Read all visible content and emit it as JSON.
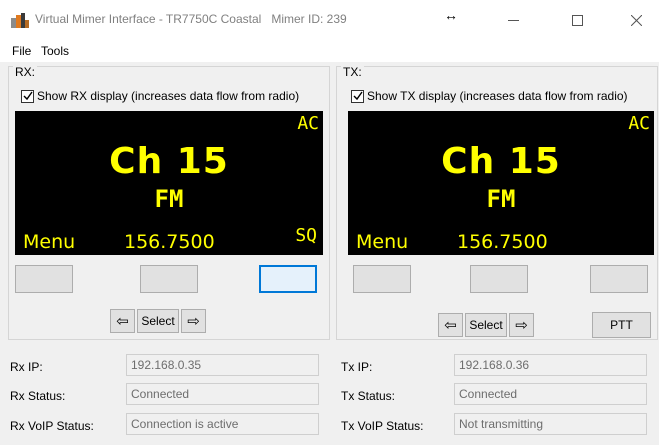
{
  "window": {
    "title": "Virtual Mimer Interface - TR7750C Coastal",
    "mimer_id": "Mimer ID: 239",
    "controls": {
      "minimize": "—",
      "maximize": "☐",
      "close": "✕"
    }
  },
  "menu": {
    "file": "File",
    "tools": "Tools"
  },
  "rx": {
    "group_label": "RX:",
    "show_display_label": "Show RX display (increases data flow from radio)",
    "show_display_checked": true,
    "display": {
      "ac": "AC",
      "channel": "Ch 15",
      "mode": "FM",
      "menu": "Menu",
      "frequency": "156.7500",
      "sq": "SQ"
    },
    "nav": {
      "left": "⇦",
      "select": "Select",
      "right": "⇨"
    }
  },
  "tx": {
    "group_label": "TX:",
    "show_display_label": "Show TX display (increases data flow from radio)",
    "show_display_checked": true,
    "display": {
      "ac": "AC",
      "channel": "Ch 15",
      "mode": "FM",
      "menu": "Menu",
      "frequency": "156.7500"
    },
    "nav": {
      "left": "⇦",
      "select": "Select",
      "right": "⇨"
    },
    "ptt": "PTT"
  },
  "status": {
    "rx_ip_label": "Rx IP:",
    "rx_ip": "192.168.0.35",
    "rx_status_label": "Rx Status:",
    "rx_status": "Connected",
    "rx_voip_label": "Rx VoIP Status:",
    "rx_voip": "Connection is active",
    "tx_ip_label": "Tx IP:",
    "tx_ip": "192.168.0.36",
    "tx_status_label": "Tx Status:",
    "tx_status": "Connected",
    "tx_voip_label": "Tx VoIP Status:",
    "tx_voip": "Not transmitting"
  },
  "colors": {
    "display_bg": "#000000",
    "display_text": "#ffff00",
    "focus": "#0078d7"
  }
}
